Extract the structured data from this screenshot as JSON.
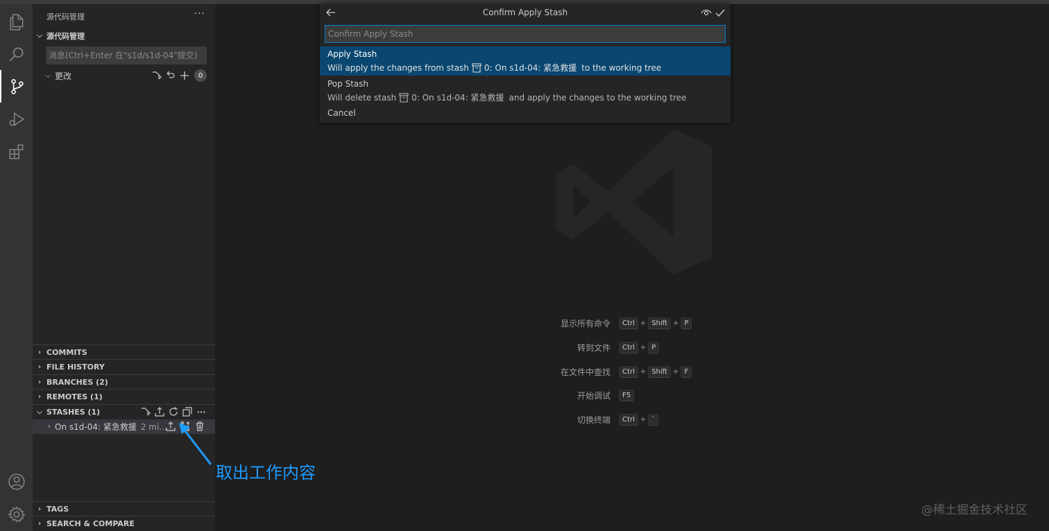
{
  "sidebar": {
    "title": "源代码管理",
    "section_title": "源代码管理",
    "message_placeholder": "消息(Ctrl+Enter 在\"s1d/s1d-04\"提交)",
    "changes_label": "更改",
    "changes_count": "0",
    "more_label": "···",
    "sections": {
      "commits": "COMMITS",
      "file_history": "FILE HISTORY",
      "branches": "BRANCHES (2)",
      "remotes": "REMOTES (1)",
      "stashes": "STASHES (1)",
      "tags": "TAGS",
      "search_compare": "SEARCH & COMPARE"
    },
    "stash_item": {
      "name": "On s1d-04: 紧急救援",
      "time": "2 mi..."
    }
  },
  "quickpick": {
    "title": "Confirm Apply Stash",
    "input_placeholder": "Confirm Apply Stash",
    "items": [
      {
        "label": "Apply Stash",
        "detail_prefix": "Will apply the changes from stash",
        "detail_stash": "0: On s1d-04: 紧急救援",
        "detail_suffix": "to the working tree"
      },
      {
        "label": "Pop Stash",
        "detail_prefix": "Will delete stash",
        "detail_stash": "0: On s1d-04: 紧急救援",
        "detail_suffix": "and apply the changes to the working tree"
      },
      {
        "label": "Cancel"
      }
    ]
  },
  "shortcuts": [
    {
      "label": "显示所有命令",
      "keys": [
        "Ctrl",
        "Shift",
        "P"
      ]
    },
    {
      "label": "转到文件",
      "keys": [
        "Ctrl",
        "P"
      ]
    },
    {
      "label": "在文件中查找",
      "keys": [
        "Ctrl",
        "Shift",
        "F"
      ]
    },
    {
      "label": "开始调试",
      "keys": [
        "F5"
      ]
    },
    {
      "label": "切换终端",
      "keys": [
        "Ctrl",
        "`"
      ]
    }
  ],
  "annotation": "取出工作内容",
  "watermark_text": "@稀土掘金技术社区",
  "colors": {
    "accent": "#094771",
    "annotation": "#1e9bff",
    "focus_border": "#007fd4"
  }
}
